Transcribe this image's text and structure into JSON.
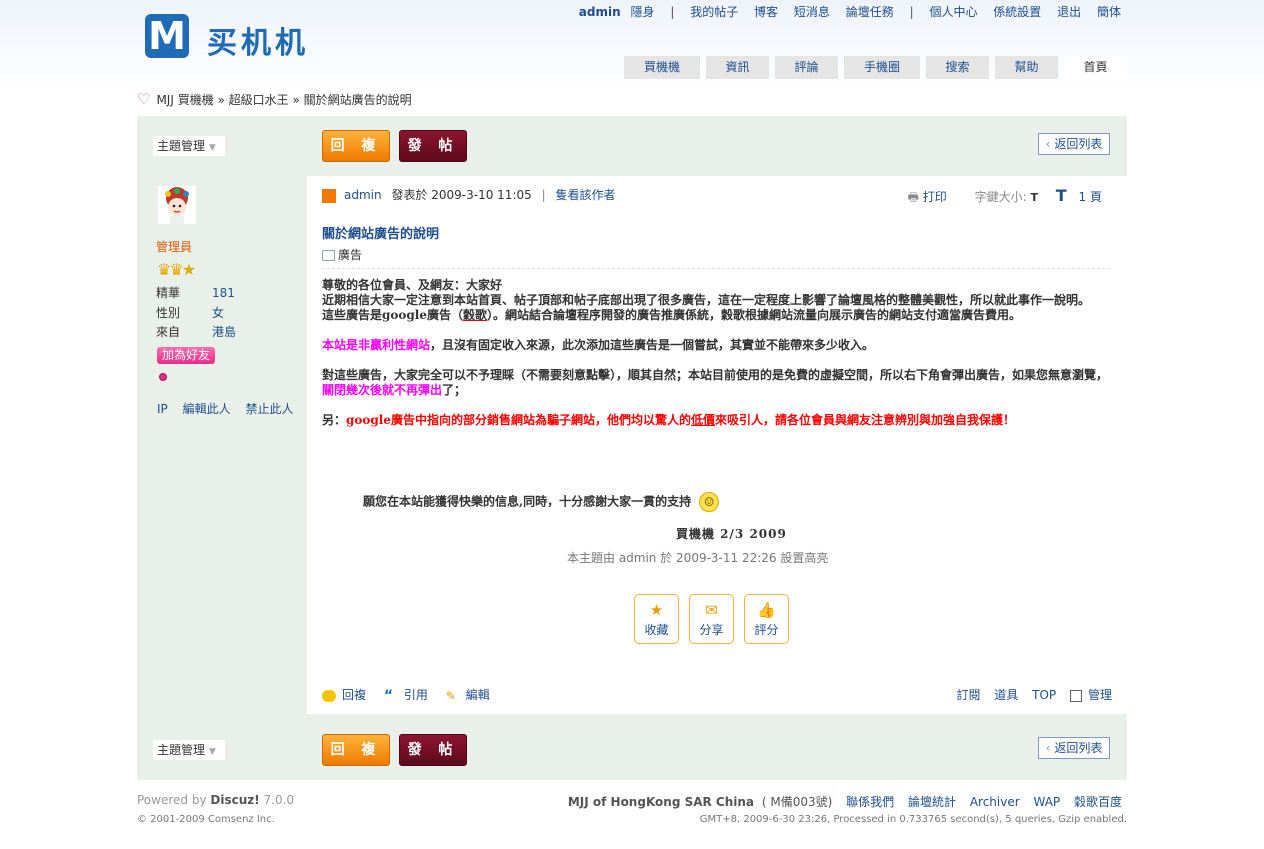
{
  "site": {
    "logo_mark": "M",
    "logo_text": "买机机"
  },
  "topnav": {
    "user": "admin",
    "items": [
      "隱身",
      "|",
      "我的帖子",
      "博客",
      "短消息",
      "論壇任務",
      "|",
      "個人中心",
      "係統設置",
      "退出",
      "簡体"
    ]
  },
  "tabs": [
    "買機機",
    "資訊",
    "評論",
    "手機圈",
    "搜索",
    "幫助",
    "首頁"
  ],
  "breadcrumb": "MJJ 買機機 » 超級口水王 » 關於網站廣告的說明",
  "toolbar": {
    "thread_manage": "主題管理",
    "reply": "回 複",
    "post": "發 帖",
    "back_to_list": "返回列表"
  },
  "user": {
    "role": "管理員",
    "stats": [
      {
        "k": "精華",
        "v": "181"
      },
      {
        "k": "性別",
        "v": "女"
      },
      {
        "k": "來自",
        "v": "港島"
      }
    ],
    "add_friend": "加為好友",
    "links": [
      "IP",
      "編輯此人",
      "禁止此人"
    ]
  },
  "post": {
    "author": "admin",
    "posted_at": "發表於 2009-3-10 11:05",
    "sep": "|",
    "only_author": "隻看該作者",
    "print": "打印",
    "font_size_label": "字鍵大小:",
    "font_t_small": "T",
    "font_t_big": "T",
    "floor": "1 頁",
    "title": "關於網站廣告的說明",
    "tag": "廣告",
    "para1_line1": "尊敬的各位會員、及網友：大家好",
    "para1_line2": "近期相信大家一定注意到本站首頁、帖子頂部和帖子底部出現了很多廣告，這在一定程度上影響了論壇風格的整體美觀性，所以就此事作一說明。",
    "para1_line3a": "這些廣告是google廣告（",
    "para1_line3u": "穀歌",
    "para1_line3b": "）。網站結合論壇程序開發的廣告推廣係統，穀歌根據網站流量向展示廣告的網站支付適當廣告費用。",
    "para2_mag": "本站是非贏利性網站",
    "para2_rest": "，且沒有固定收入來源，此次添加這些廣告是一個嘗試，其實並不能帶來多少收入。",
    "para3_a": "對這些廣告，大家完全可以不予理睬（不需要刻意點擊），順其自然；本站目前使用的是免費的虛擬空間，所以右下角會彈出廣告，如果您無意瀏覽，",
    "para3_mag": "關閉幾次後就不再彈出",
    "para3_b": "了；",
    "para4_a": "另：",
    "para4_red1": "google廣告中指向的部分銷售網站為騙子網站，他們均以驚人的",
    "para4_redu": "低價",
    "para4_red2": "來吸引人，請各位會員與網友注意辨別與加強自我保護！",
    "blessing": "願您在本站能獲得快樂的信息,同時，十分感謝大家一貫的支持",
    "signature": "買機機    2/3  2009",
    "highlight_note": "本主題由 admin 於 2009-3-11 22:26 設置高亮",
    "actions": [
      {
        "icon": "star-icon",
        "glyph": "★",
        "label": "收藏"
      },
      {
        "icon": "share-icon",
        "glyph": "✉",
        "label": "分享"
      },
      {
        "icon": "rate-icon",
        "glyph": "👍",
        "label": "評分"
      }
    ],
    "footer_left": [
      "回複",
      "引用",
      "編輯"
    ],
    "footer_right": [
      "訂閱",
      "道具",
      "TOP",
      "管理"
    ]
  },
  "footer": {
    "powered_prefix": "Powered by ",
    "powered_name": "Discuz!",
    "version": " 7.0.0",
    "copyright": "© 2001-2009 Comsenz Inc.",
    "site_name": "MJJ of HongKong SAR China",
    "icp": "( M備003號)",
    "links": [
      "聯係我們",
      "論壇統計",
      "Archiver",
      "WAP",
      "穀歌百度"
    ],
    "gmt": "GMT+8, 2009-6-30 23:26, Processed in 0.733765 second(s), 5 queries, Gzip enabled."
  },
  "colors": {
    "link": "#1f4f8a",
    "panel_bg": "#e9efe9",
    "accent_orange": "#f07a00",
    "post_btn": "#6d0d22",
    "magenta": "#ff00ff",
    "red": "#ff0000"
  }
}
